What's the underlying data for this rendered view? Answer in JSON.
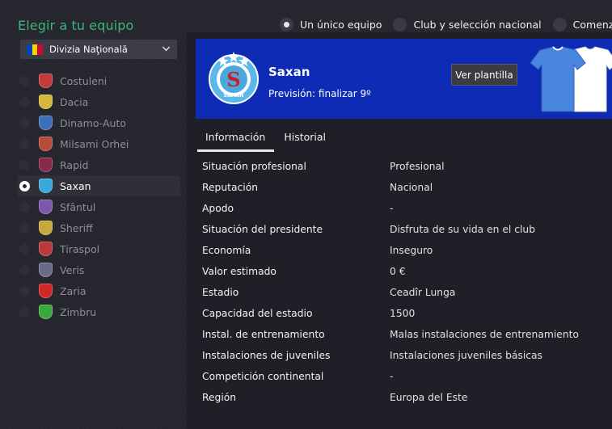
{
  "header": {
    "title": "Elegir a tu equipo"
  },
  "modes": [
    {
      "label": "Un único equipo",
      "selected": true
    },
    {
      "label": "Club y selección nacional",
      "selected": false
    },
    {
      "label": "Comenzar en",
      "selected": false
    }
  ],
  "league_dropdown": {
    "value": "Divizia Naţională",
    "flag_colors": [
      "#0046ae",
      "#ffd200",
      "#cc092f"
    ]
  },
  "teams": [
    {
      "name": "Costuleni",
      "crest_color": "#c33a3a",
      "selected": false
    },
    {
      "name": "Dacia",
      "crest_color": "#d4b63a",
      "selected": false
    },
    {
      "name": "Dinamo-Auto",
      "crest_color": "#3d6fb8",
      "selected": false
    },
    {
      "name": "Milsami Orhei",
      "crest_color": "#b84a3a",
      "selected": false
    },
    {
      "name": "Rapid",
      "crest_color": "#8a2a4a",
      "selected": false
    },
    {
      "name": "Saxan",
      "crest_color": "#3aa8d8",
      "selected": true
    },
    {
      "name": "Sfântul",
      "crest_color": "#7a5aa8",
      "selected": false
    },
    {
      "name": "Sheriff",
      "crest_color": "#c8a83a",
      "selected": false
    },
    {
      "name": "Tiraspol",
      "crest_color": "#b83a3a",
      "selected": false
    },
    {
      "name": "Veris",
      "crest_color": "#6a6a8a",
      "selected": false
    },
    {
      "name": "Zaria",
      "crest_color": "#d02828",
      "selected": false
    },
    {
      "name": "Zimbru",
      "crest_color": "#3aa83a",
      "selected": false
    }
  ],
  "club": {
    "name": "Saxan",
    "forecast": "Previsión: finalizar 9º",
    "view_squad_label": "Ver plantilla",
    "hero_color": "#0d2bb5",
    "logo_text": "SAXAN"
  },
  "tabs": [
    {
      "label": "Información",
      "active": true
    },
    {
      "label": "Historial",
      "active": false
    }
  ],
  "info_rows": [
    {
      "key": "Situación profesional",
      "value": "Profesional"
    },
    {
      "key": "Reputación",
      "value": "Nacional"
    },
    {
      "key": "Apodo",
      "value": "-"
    },
    {
      "key": "Situación del presidente",
      "value": "Disfruta de su vida en el club"
    },
    {
      "key": "Economía",
      "value": "Inseguro"
    },
    {
      "key": "Valor estimado",
      "value": "0 €"
    },
    {
      "key": "Estadio",
      "value": "Ceadîr Lunga"
    },
    {
      "key": "Capacidad del estadio",
      "value": "1500"
    },
    {
      "key": "Instal. de entrenamiento",
      "value": "Malas instalaciones de entrenamiento"
    },
    {
      "key": "Instalaciones de juveniles",
      "value": "Instalaciones juveniles básicas"
    },
    {
      "key": "Competición continental",
      "value": "-"
    },
    {
      "key": "Región",
      "value": "Europa del Este"
    }
  ]
}
